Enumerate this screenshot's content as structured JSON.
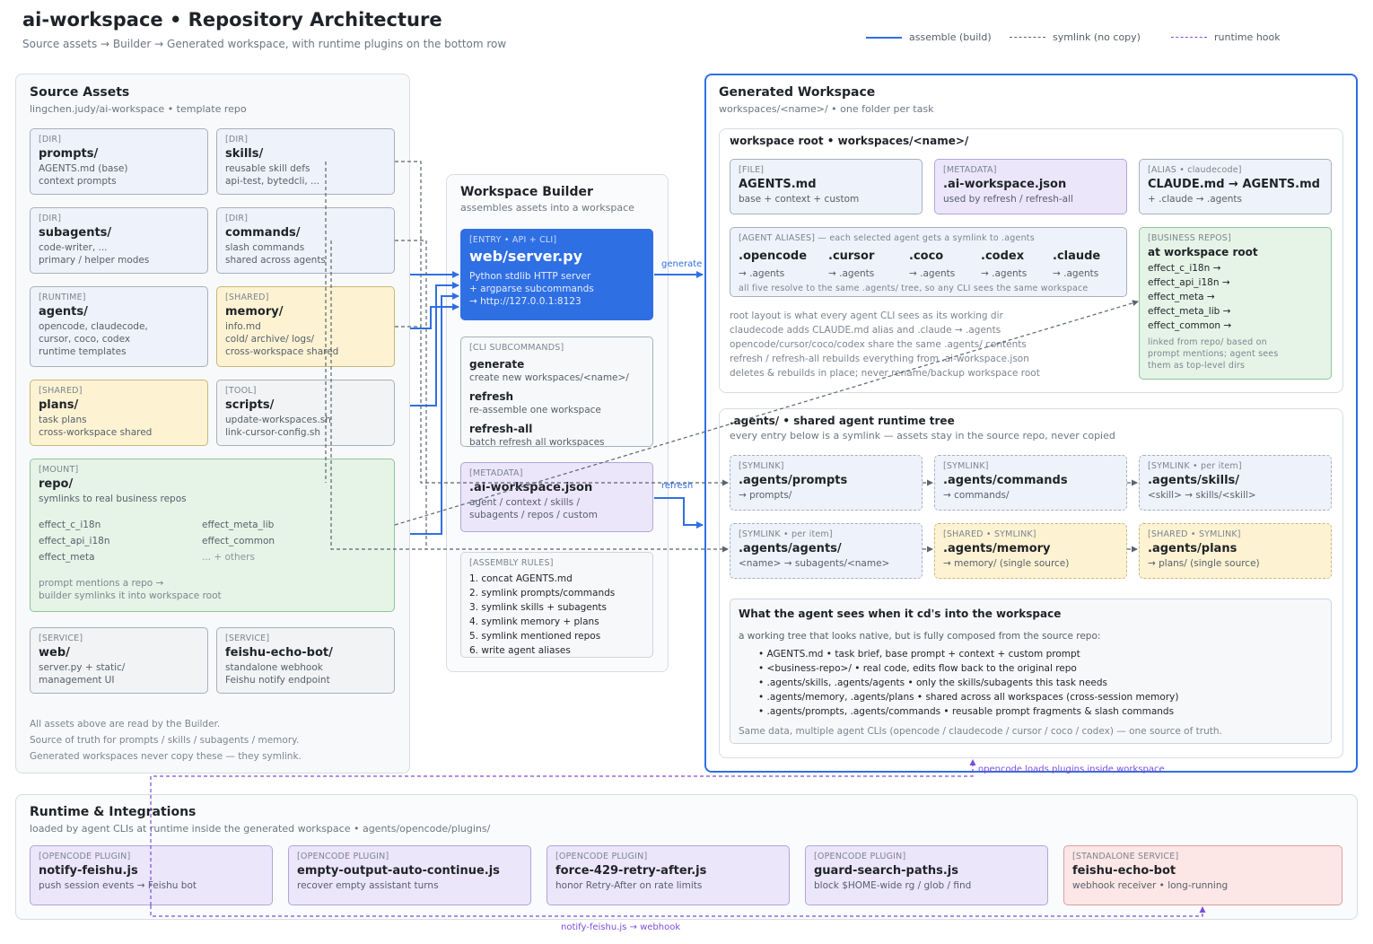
{
  "header": {
    "title": "ai-workspace • Repository Architecture",
    "subtitle": "Source assets → Builder → Generated workspace, with runtime plugins on the bottom row"
  },
  "legend": {
    "build": "assemble (build)",
    "symlink": "symlink (no copy)",
    "hook": "runtime hook"
  },
  "colors": {
    "accent": "#2f6fe4",
    "hook": "#7c4ddb",
    "line": "#5b6470"
  },
  "source": {
    "title": "Source Assets",
    "sub": "lingchen.judy/ai-workspace • template repo",
    "prompts": {
      "tag": "[DIR]",
      "name": "prompts/",
      "d1": "AGENTS.md (base)",
      "d2": "context prompts"
    },
    "skills": {
      "tag": "[DIR]",
      "name": "skills/",
      "d1": "reusable skill defs",
      "d2": "api-test, bytedcli, ..."
    },
    "subagents": {
      "tag": "[DIR]",
      "name": "subagents/",
      "d1": "code-writer, ...",
      "d2": "primary / helper modes"
    },
    "commands": {
      "tag": "[DIR]",
      "name": "commands/",
      "d1": "slash commands",
      "d2": "shared across agents"
    },
    "agents": {
      "tag": "[RUNTIME]",
      "name": "agents/",
      "d1": "opencode, claudecode,",
      "d2": "cursor, coco, codex",
      "d3": "runtime templates"
    },
    "memory": {
      "tag": "[SHARED]",
      "name": "memory/",
      "d1": "info.md",
      "d2": "cold/ archive/ logs/",
      "d3": "cross-workspace shared"
    },
    "plans": {
      "tag": "[SHARED]",
      "name": "plans/",
      "d1": "task plans",
      "d2": "cross-workspace shared"
    },
    "scripts": {
      "tag": "[TOOL]",
      "name": "scripts/",
      "d1": "update-workspaces.sh",
      "d2": "link-cursor-config.sh"
    },
    "repo": {
      "tag": "[MOUNT]",
      "name": "repo/",
      "d1": "symlinks to real business repos",
      "items": [
        "effect_c_i18n",
        "effect_meta_lib",
        "effect_api_i18n",
        "effect_common",
        "effect_meta",
        "... + others"
      ],
      "n1": "prompt mentions a repo →",
      "n2": "builder symlinks it into workspace root"
    },
    "web": {
      "tag": "[SERVICE]",
      "name": "web/",
      "d1": "server.py + static/",
      "d2": "management UI"
    },
    "feishu": {
      "tag": "[SERVICE]",
      "name": "feishu-echo-bot/",
      "d1": "standalone webhook",
      "d2": "Feishu notify endpoint"
    },
    "notes": [
      "All assets above are read by the Builder.",
      "Source of truth for prompts / skills / subagents / memory.",
      "Generated workspaces never copy these — they symlink."
    ]
  },
  "builder": {
    "title": "Workspace Builder",
    "sub": "assembles assets into a workspace",
    "entry": {
      "tag": "[ENTRY • API + CLI]",
      "name": "web/server.py",
      "d1": "Python stdlib HTTP server",
      "d2": "+ argparse subcommands",
      "d3": "→ http://127.0.0.1:8123"
    },
    "cli": {
      "tag": "[CLI SUBCOMMANDS]",
      "c1": "generate",
      "c1d": "create new workspaces/<name>/",
      "c2": "refresh",
      "c2d": "re-assemble one workspace",
      "c3": "refresh-all",
      "c3d": "batch refresh all workspaces"
    },
    "meta": {
      "tag": "[METADATA]",
      "name": ".ai-workspace.json",
      "d1": "agent / context / skills /",
      "d2": "subagents / repos / custom"
    },
    "rules": {
      "tag": "[ASSEMBLY RULES]",
      "items": [
        "1. concat AGENTS.md",
        "2. symlink prompts/commands",
        "3. symlink skills + subagents",
        "4. symlink memory + plans",
        "5. symlink mentioned repos",
        "6. write agent aliases"
      ]
    },
    "generate_label": "generate",
    "refresh_label": "refresh"
  },
  "generated": {
    "title": "Generated Workspace",
    "sub": "workspaces/<name>/ • one folder per task",
    "root": {
      "title": "workspace root • workspaces/<name>/",
      "agents_md": {
        "tag": "[FILE]",
        "name": "AGENTS.md",
        "d1": "base + context + custom"
      },
      "json": {
        "tag": "[METADATA]",
        "name": ".ai-workspace.json",
        "d1": "used by refresh / refresh-all"
      },
      "claude": {
        "tag": "[ALIAS • claudecode]",
        "name": "CLAUDE.md → AGENTS.md",
        "d1": "+ .claude → .agents"
      },
      "aliases": {
        "tag": "[AGENT ALIASES] — each selected agent gets a symlink to .agents",
        "items": [
          {
            "n": ".opencode",
            "t": "→ .agents"
          },
          {
            "n": ".cursor",
            "t": "→ .agents"
          },
          {
            "n": ".coco",
            "t": "→ .agents"
          },
          {
            "n": ".codex",
            "t": "→ .agents"
          },
          {
            "n": ".claude",
            "t": "→ .agents"
          }
        ],
        "foot": "all five resolve to the same .agents/ tree, so any CLI sees the same workspace"
      },
      "business": {
        "tag": "[BUSINESS REPOS]",
        "name": "at workspace root",
        "items": [
          "effect_c_i18n →",
          "effect_api_i18n →",
          "effect_meta →",
          "effect_meta_lib →",
          "effect_common →"
        ],
        "n1": "linked from repo/ based on",
        "n2": "prompt mentions; agent sees",
        "n3": "them as top-level dirs"
      },
      "notes": [
        "root layout is what every agent CLI sees as its working dir",
        "claudecode adds CLAUDE.md alias and .claude → .agents",
        "opencode/cursor/coco/codex share the same .agents/ contents",
        "refresh / refresh-all rebuilds everything from .ai-workspace.json",
        "deletes & rebuilds in place; never rename/backup workspace root"
      ]
    },
    "tree": {
      "title": ".agents/ • shared agent runtime tree",
      "sub": "every entry below is a symlink — assets stay in the source repo, never copied",
      "prompts": {
        "tag": "[SYMLINK]",
        "name": ".agents/prompts",
        "d1": "→ prompts/"
      },
      "commands": {
        "tag": "[SYMLINK]",
        "name": ".agents/commands",
        "d1": "→ commands/"
      },
      "skills": {
        "tag": "[SYMLINK • per item]",
        "name": ".agents/skills/",
        "d1": "<skill> → skills/<skill>"
      },
      "agents": {
        "tag": "[SYMLINK • per item]",
        "name": ".agents/agents/",
        "d1": "<name> → subagents/<name>"
      },
      "memory": {
        "tag": "[SHARED • SYMLINK]",
        "name": ".agents/memory",
        "d1": "→ memory/ (single source)"
      },
      "plans": {
        "tag": "[SHARED • SYMLINK]",
        "name": ".agents/plans",
        "d1": "→ plans/ (single source)"
      }
    },
    "sees": {
      "title": "What the agent sees when it cd's into the workspace",
      "intro": "a working tree that looks native, but is fully composed from the source repo:",
      "items": [
        "AGENTS.md • task brief, base prompt + context + custom prompt",
        "<business-repo>/ • real code, edits flow back to the original repo",
        ".agents/skills, .agents/agents • only the skills/subagents this task needs",
        ".agents/memory, .agents/plans • shared across all workspaces (cross-session memory)",
        ".agents/prompts, .agents/commands • reusable prompt fragments & slash commands"
      ],
      "foot": "Same data, multiple agent CLIs (opencode / claudecode / cursor / coco / codex) — one source of truth."
    }
  },
  "runtime": {
    "title": "Runtime & Integrations",
    "sub": "loaded by agent CLIs at runtime inside the generated workspace • agents/opencode/plugins/",
    "plugins": [
      {
        "tag": "[OPENCODE PLUGIN]",
        "name": "notify-feishu.js",
        "d1": "push session events → Feishu bot"
      },
      {
        "tag": "[OPENCODE PLUGIN]",
        "name": "empty-output-auto-continue.js",
        "d1": "recover empty assistant turns"
      },
      {
        "tag": "[OPENCODE PLUGIN]",
        "name": "force-429-retry-after.js",
        "d1": "honor Retry-After on rate limits"
      },
      {
        "tag": "[OPENCODE PLUGIN]",
        "name": "guard-search-paths.js",
        "d1": "block $HOME-wide rg / glob / find"
      },
      {
        "tag": "[STANDALONE SERVICE]",
        "name": "feishu-echo-bot",
        "d1": "webhook receiver • long-running"
      }
    ],
    "load_label": "opencode loads plugins inside workspace",
    "webhook_label": "notify-feishu.js → webhook"
  }
}
